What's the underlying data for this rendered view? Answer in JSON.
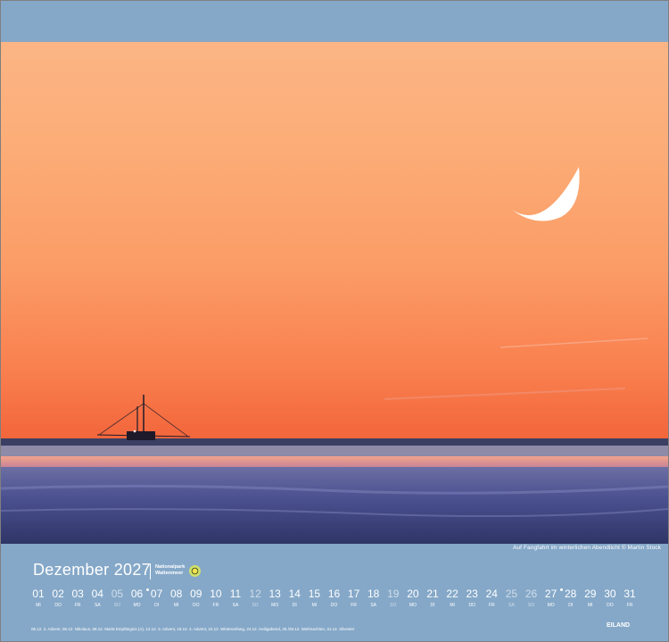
{
  "caption": "Auf Fangfahrt im winterlichen Abendlicht © Martin Stock",
  "month_title": "Dezember 2027",
  "logo": {
    "line1": "Nationalpark",
    "line2": "Wattenmeer"
  },
  "days": [
    {
      "num": "01",
      "wd": "MI"
    },
    {
      "num": "02",
      "wd": "DO"
    },
    {
      "num": "03",
      "wd": "FR"
    },
    {
      "num": "04",
      "wd": "SA"
    },
    {
      "num": "05",
      "wd": "SO",
      "sunday": true
    },
    {
      "num": "06",
      "wd": "MO",
      "marked": true
    },
    {
      "num": "07",
      "wd": "DI"
    },
    {
      "num": "08",
      "wd": "MI"
    },
    {
      "num": "09",
      "wd": "DO"
    },
    {
      "num": "10",
      "wd": "FR"
    },
    {
      "num": "11",
      "wd": "SA"
    },
    {
      "num": "12",
      "wd": "SO",
      "sunday": true
    },
    {
      "num": "13",
      "wd": "MO"
    },
    {
      "num": "14",
      "wd": "DI"
    },
    {
      "num": "15",
      "wd": "MI"
    },
    {
      "num": "16",
      "wd": "DO"
    },
    {
      "num": "17",
      "wd": "FR"
    },
    {
      "num": "18",
      "wd": "SA"
    },
    {
      "num": "19",
      "wd": "SO",
      "sunday": true
    },
    {
      "num": "20",
      "wd": "MO"
    },
    {
      "num": "21",
      "wd": "DI"
    },
    {
      "num": "22",
      "wd": "MI"
    },
    {
      "num": "23",
      "wd": "DO"
    },
    {
      "num": "24",
      "wd": "FR"
    },
    {
      "num": "25",
      "wd": "SA",
      "sunday": true
    },
    {
      "num": "26",
      "wd": "SO",
      "sunday": true
    },
    {
      "num": "27",
      "wd": "MO",
      "marked": true
    },
    {
      "num": "28",
      "wd": "DI"
    },
    {
      "num": "29",
      "wd": "MI"
    },
    {
      "num": "30",
      "wd": "DO"
    },
    {
      "num": "31",
      "wd": "FR"
    }
  ],
  "holidays": "05.12. 2. Advent, 06.12. Nikolaus, 08.12. Mariä Empfängnis (A), 12.12. 3. Advent, 19.12. 4. Advent, 22.12. Winteranfang, 24.12. Heiligabend, 25./26.12. Weihnachten, 31.12. Silvester",
  "publisher": "EILAND",
  "colors": {
    "frame": "#85a8c8",
    "sky_top": "#fbb585",
    "sky_horizon": "#e24d2e",
    "water": "#4a4f86"
  }
}
